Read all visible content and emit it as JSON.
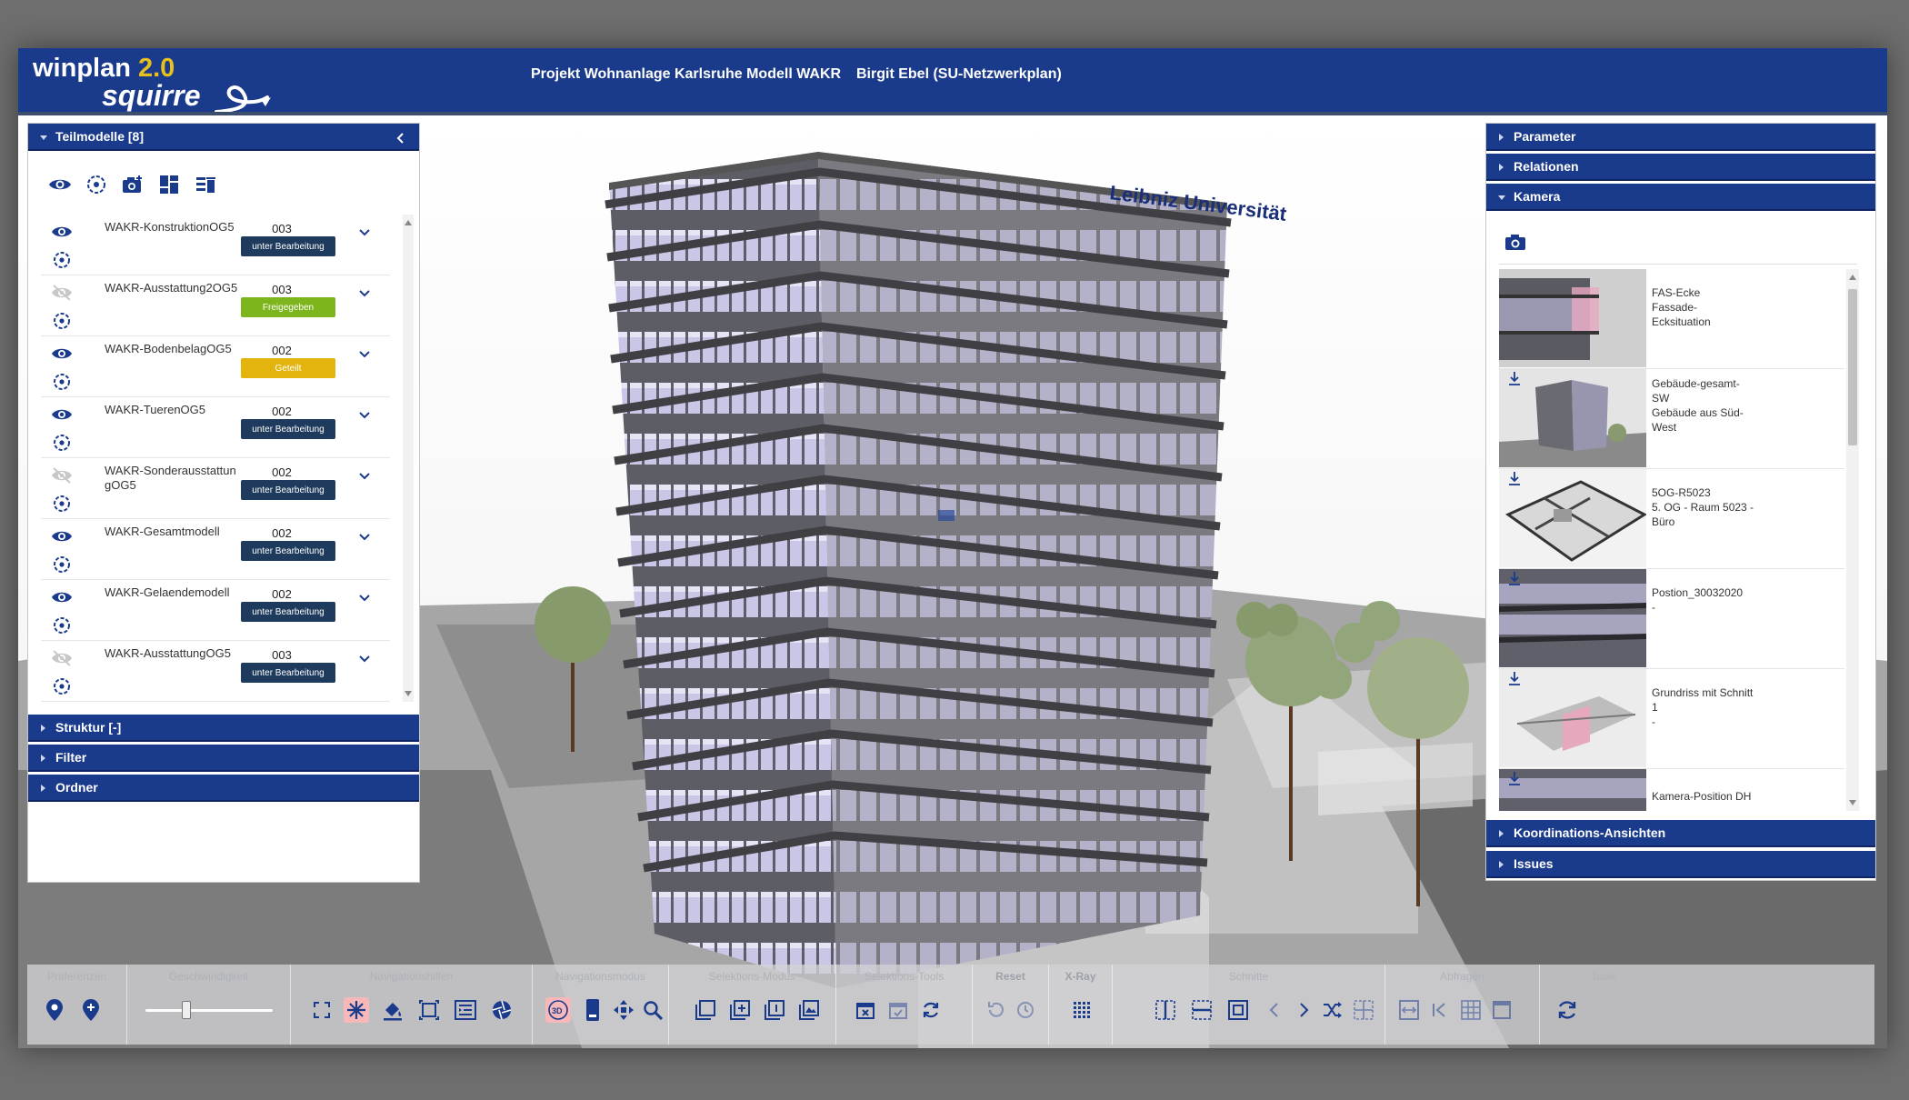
{
  "app": {
    "logo_main": "winplan",
    "logo_version": "2.0",
    "logo_sub": "squirre",
    "project_title": "Projekt Wohnanlage Karlsruhe Modell WAKR",
    "user_title": "Birgit Ebel (SU-Netzwerkplan)"
  },
  "colors": {
    "header": "#1a3a8c",
    "icon_blue": "#1a3a8c",
    "badge_in_progress": "#1e3a5c",
    "badge_released": "#7cb51c",
    "badge_shared": "#e3b40e"
  },
  "left_panel": {
    "title": "Teilmodelle [8]",
    "toolbar_icons": [
      "eye-icon",
      "target-icon",
      "add-camera-icon",
      "layout-icon",
      "delete-list-icon"
    ],
    "models": [
      {
        "name": "WAKR-KonstruktionOG5",
        "number": "003",
        "status": "unter Bearbeitung",
        "visible": true
      },
      {
        "name": "WAKR-Ausstattung2OG5",
        "number": "003",
        "status": "Freigegeben",
        "visible": false
      },
      {
        "name": "WAKR-BodenbelagOG5",
        "number": "002",
        "status": "Geteilt",
        "visible": true
      },
      {
        "name": "WAKR-TuerenOG5",
        "number": "002",
        "status": "unter Bearbeitung",
        "visible": true
      },
      {
        "name": "WAKR-SonderausstattungOG5",
        "number": "002",
        "status": "unter Bearbeitung",
        "visible": false
      },
      {
        "name": "WAKR-Gesamtmodell",
        "number": "002",
        "status": "unter Bearbeitung",
        "visible": true
      },
      {
        "name": "WAKR-Gelaendemodell",
        "number": "002",
        "status": "unter Bearbeitung",
        "visible": true
      },
      {
        "name": "WAKR-AusstattungOG5",
        "number": "003",
        "status": "unter Bearbeitung",
        "visible": false
      }
    ],
    "sections": [
      "Struktur [-]",
      "Filter",
      "Ordner"
    ]
  },
  "right_panel": {
    "sections_top": [
      "Parameter",
      "Relationen",
      "Kamera"
    ],
    "camera_positions": [
      {
        "lines": [
          "FAS-Ecke",
          "Fassade-",
          "Ecksituation"
        ]
      },
      {
        "lines": [
          "Gebäude-gesamt-",
          "SW",
          "Gebäude aus Süd-",
          "West"
        ]
      },
      {
        "lines": [
          "5OG-R5023",
          "5. OG - Raum 5023 -",
          "Büro"
        ]
      },
      {
        "lines": [
          "Postion_30032020",
          "-"
        ]
      },
      {
        "lines": [
          "Grundriss mit Schnitt",
          "1",
          "-"
        ]
      },
      {
        "lines": [
          "Kamera-Position DH"
        ]
      }
    ],
    "sections_bottom": [
      "Koordinations-Ansichten",
      "Issues"
    ]
  },
  "scene": {
    "building_sign": "Leibniz Universität"
  },
  "toolbar": {
    "groups": [
      "Präferenzen",
      "Geschwindigkeit",
      "Navigationshilfen",
      "Navigationsmodus",
      "Selektions-Modus",
      "Selektions-Tools",
      "Reset",
      "X-Ray",
      "Schnitte",
      "Abfragen",
      "Tools"
    ]
  }
}
